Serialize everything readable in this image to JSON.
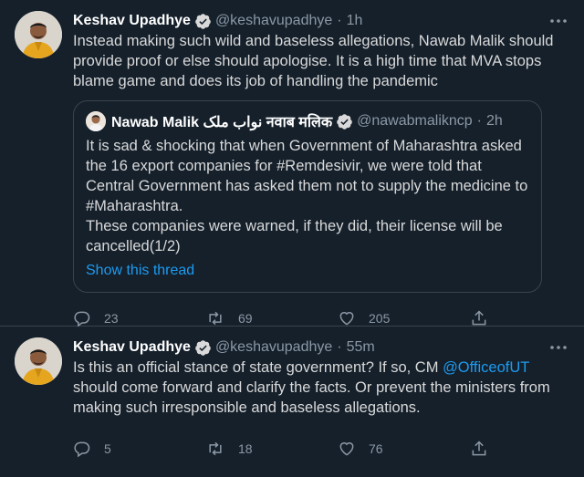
{
  "tweets": [
    {
      "author": "Keshav Upadhye",
      "handle": "@keshavupadhye",
      "sep": "·",
      "time": "1h",
      "text": "Instead making such wild and baseless allegations, Nawab Malik should provide proof or else should apologise. It is a high time that MVA stops blame game and does its job of handling the pandemic",
      "quote": {
        "author": "Nawab Malik نواب ملک नवाब मलिक",
        "handle": "@nawabmaliknc​p",
        "sep": "·",
        "time": "2h",
        "text_line1": "It is sad & shocking that when Government of Maharashtra asked the 16 export companies for #Remdesivir, we were told that Central Government has asked them not to supply the medicine to #Maharashtra.",
        "text_line2": "These companies were warned, if they did, their license will be cancelled(1/2)",
        "show_thread": "Show this thread"
      },
      "replies": "23",
      "retweets": "69",
      "likes": "205"
    },
    {
      "author": "Keshav Upadhye",
      "handle": "@keshavupadhye",
      "sep": "·",
      "time": "55m",
      "text_before": "Is this an official stance of state government? If so, CM ",
      "mention": "@OfficeofUT",
      "text_after": " should come forward and clarify the facts. Or prevent the ministers from making such irresponsible and baseless allegations.",
      "replies": "5",
      "retweets": "18",
      "likes": "76"
    }
  ],
  "icons": {
    "verified": "verified-badge-icon",
    "more": "more-options-icon",
    "reply": "reply-icon",
    "retweet": "retweet-icon",
    "like": "heart-icon",
    "share": "share-icon"
  },
  "colors": {
    "background": "#15202b",
    "accent": "#1d9bf0",
    "muted": "#8b98a5",
    "divider": "#38444d"
  }
}
